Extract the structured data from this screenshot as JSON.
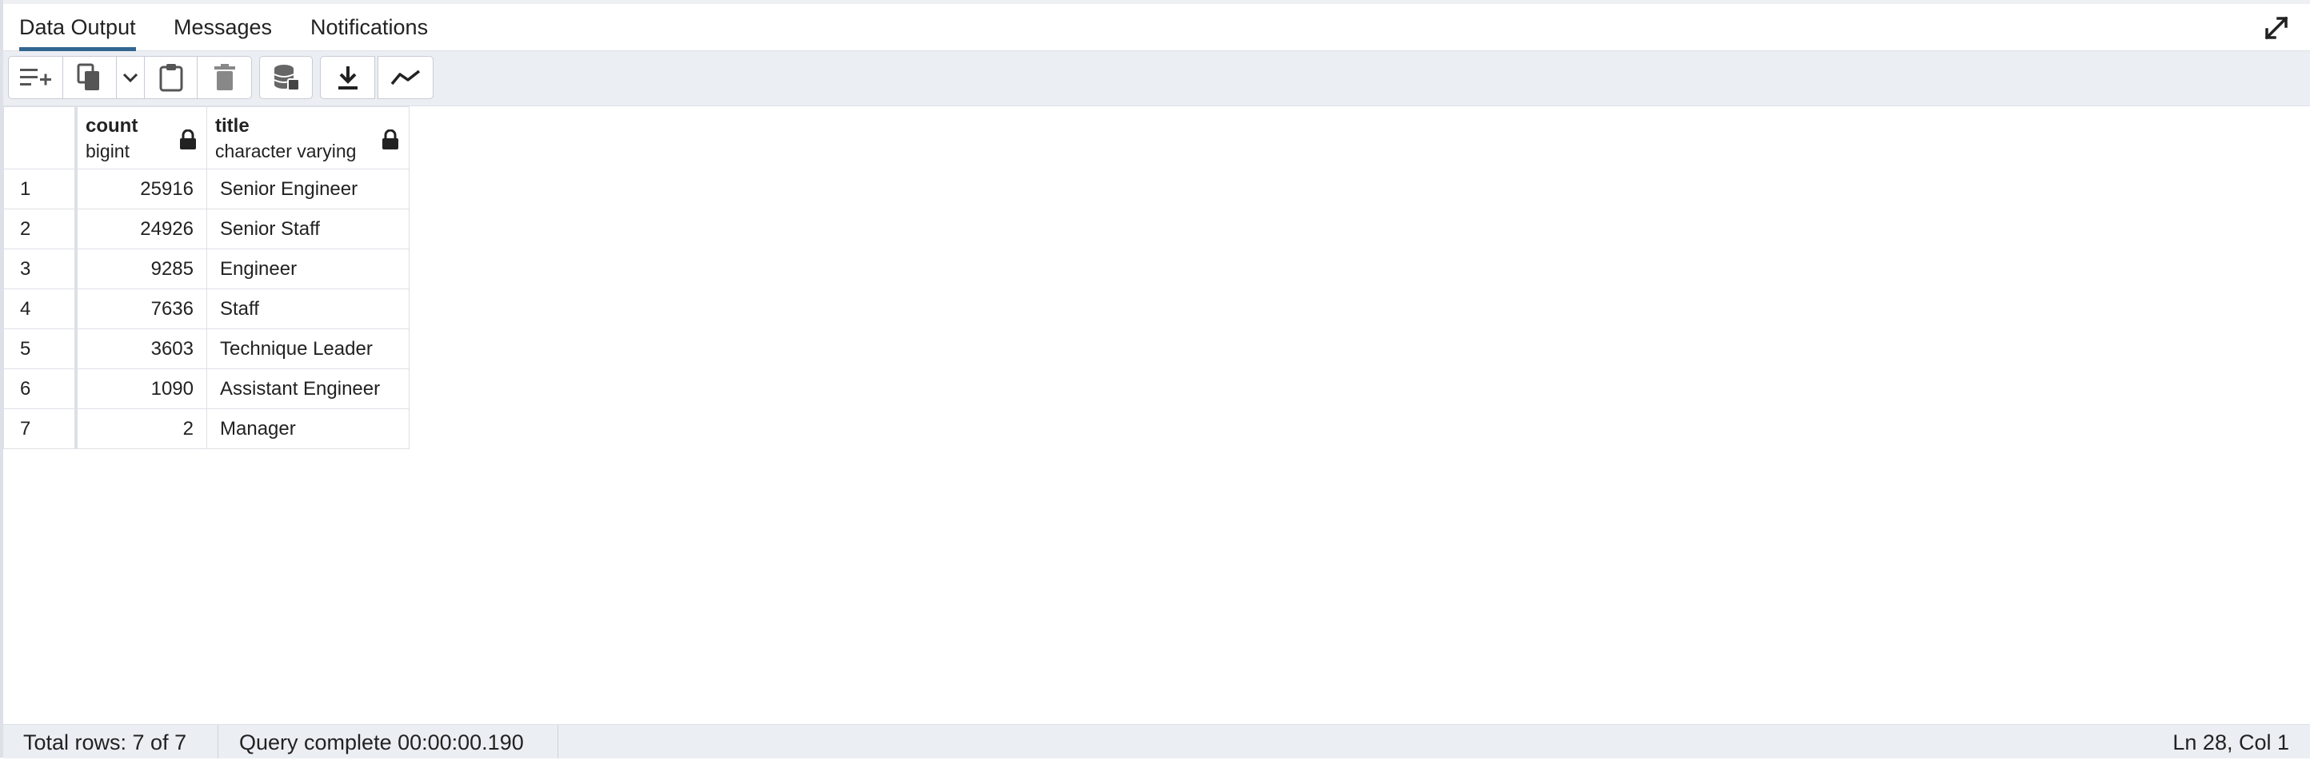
{
  "tabs": [
    {
      "label": "Data Output",
      "active": true
    },
    {
      "label": "Messages",
      "active": false
    },
    {
      "label": "Notifications",
      "active": false
    }
  ],
  "toolbar": {
    "buttons": [
      "add-row",
      "copy",
      "copy-options",
      "paste",
      "delete",
      "save-data",
      "download",
      "graph-visualiser"
    ]
  },
  "grid": {
    "columns": [
      {
        "name": "count",
        "type": "bigint"
      },
      {
        "name": "title",
        "type": "character varying"
      }
    ],
    "rows": [
      {
        "n": "1",
        "count": "25916",
        "title": "Senior Engineer"
      },
      {
        "n": "2",
        "count": "24926",
        "title": "Senior Staff"
      },
      {
        "n": "3",
        "count": "9285",
        "title": "Engineer"
      },
      {
        "n": "4",
        "count": "7636",
        "title": "Staff"
      },
      {
        "n": "5",
        "count": "3603",
        "title": "Technique Leader"
      },
      {
        "n": "6",
        "count": "1090",
        "title": "Assistant Engineer"
      },
      {
        "n": "7",
        "count": "2",
        "title": "Manager"
      }
    ]
  },
  "status": {
    "total_rows": "Total rows: 7 of 7",
    "query": "Query complete 00:00:00.190",
    "cursor": "Ln 28, Col 1"
  },
  "colors": {
    "accent": "#326690",
    "toolbar_bg": "#ebeef3",
    "border": "#dde0e6"
  }
}
